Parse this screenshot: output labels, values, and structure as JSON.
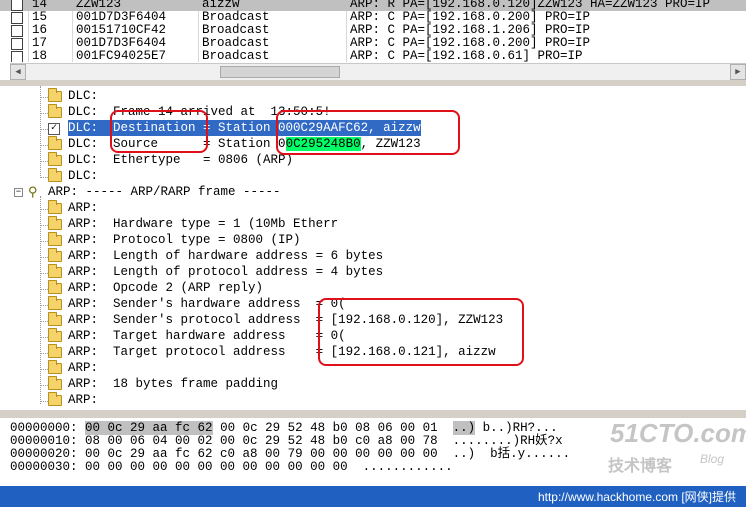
{
  "packet_list": {
    "rows": [
      {
        "no": "14",
        "src": "ZZW123",
        "dst": "aizzw",
        "summary": "ARP: R PA=[192.168.0.120]ZZW123 HA=ZZW123 PRO=IP",
        "selected": true
      },
      {
        "no": "15",
        "src": "001D7D3F6404",
        "dst": "Broadcast",
        "summary": "ARP: C PA=[192.168.0.200] PRO=IP",
        "selected": false
      },
      {
        "no": "16",
        "src": "00151710CF42",
        "dst": "Broadcast",
        "summary": "ARP: C PA=[192.168.1.206] PRO=IP",
        "selected": false
      },
      {
        "no": "17",
        "src": "001D7D3F6404",
        "dst": "Broadcast",
        "summary": "ARP: C PA=[192.168.0.200] PRO=IP",
        "selected": false
      },
      {
        "no": "18",
        "src": "001FC94025E7",
        "dst": "Broadcast",
        "summary": "ARP: C PA=[192.168.0.61] PRO=IP",
        "selected": false
      }
    ]
  },
  "detail": {
    "dlc_lines": [
      {
        "prefix": "DLC:",
        "text": ""
      },
      {
        "prefix": "DLC:",
        "text": "Frame 14 arrived at  13:50:5!"
      },
      {
        "prefix": "DLC:",
        "text": "Destination = Station 000C29AAFC62, aizzw",
        "selected": true
      },
      {
        "prefix": "DLC:",
        "text": "Source      = Station 0",
        "green": "0C295248B0",
        "tail": ", ZZW123"
      },
      {
        "prefix": "DLC:",
        "text": "Ethertype   = 0806 (ARP)"
      },
      {
        "prefix": "DLC:",
        "text": ""
      }
    ],
    "arp_header": "ARP: ----- ARP/RARP frame -----",
    "arp_lines": [
      {
        "prefix": "ARP:",
        "text": ""
      },
      {
        "prefix": "ARP:",
        "text": "Hardware type = 1 (10Mb Etherr"
      },
      {
        "prefix": "ARP:",
        "text": "Protocol type = 0800 (IP)"
      },
      {
        "prefix": "ARP:",
        "text": "Length of hardware address = 6 bytes"
      },
      {
        "prefix": "ARP:",
        "text": "Length of protocol address = 4 bytes"
      },
      {
        "prefix": "ARP:",
        "text": "Opcode 2 (ARP reply)"
      },
      {
        "prefix": "ARP:",
        "text": "Sender's hardware address  = 0("
      },
      {
        "prefix": "ARP:",
        "text": "Sender's protocol address  = [192.168.0.120], ZZW123"
      },
      {
        "prefix": "ARP:",
        "text": "Target hardware address    = 0("
      },
      {
        "prefix": "ARP:",
        "text": "Target protocol address    = [192.168.0.121], aizzw"
      },
      {
        "prefix": "ARP:",
        "text": ""
      },
      {
        "prefix": "ARP:",
        "text": "18 bytes frame padding"
      },
      {
        "prefix": "ARP:",
        "text": ""
      }
    ]
  },
  "hex": {
    "rows": [
      {
        "offset": "00000000:",
        "first": "00 0c 29 aa fc 62",
        "rest": " 00 0c 29 52 48 b0 08 06 00 01",
        "ascii_hl": "..)",
        "ascii": " b..)RH?..."
      },
      {
        "offset": "00000010:",
        "first": "",
        "rest": "08 00 06 04 00 02 00 0c 29 52 48 b0 c0 a8 00 78",
        "ascii_hl": "",
        "ascii": "........)RH妖?x"
      },
      {
        "offset": "00000020:",
        "first": "",
        "rest": "00 0c 29 aa fc 62 c0 a8 00 79 00 00 00 00 00 00",
        "ascii_hl": "",
        "ascii": "..)  b括.y......"
      },
      {
        "offset": "00000030:",
        "first": "",
        "rest": "00 00 00 00 00 00 00 00 00 00 00 00",
        "ascii_hl": "",
        "ascii": "............"
      }
    ]
  },
  "status_bar": {
    "text": "http://www.hackhome.com [网侠]提供"
  },
  "watermark": {
    "main": "51CTO.com",
    "sub": "技术博客",
    "blog": "Blog"
  },
  "colors": {
    "selection": "#316ac5",
    "highlight_green": "#00ff66",
    "annotation_red": "#e0101a",
    "status_blue": "#2060c0"
  }
}
